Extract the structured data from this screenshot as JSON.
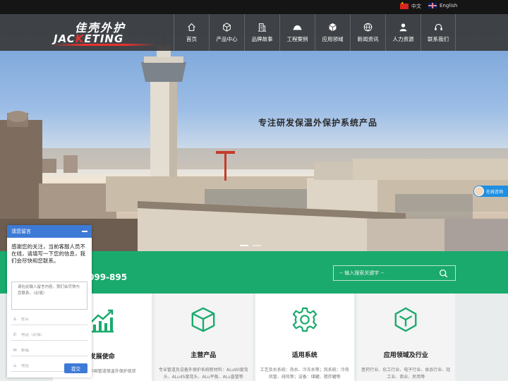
{
  "lang": {
    "cn": "中文",
    "en": "English"
  },
  "logo": {
    "cn": "佳壳外护",
    "en_pre": "JAC",
    "en_red": "K",
    "en_post": "ETING"
  },
  "nav": [
    {
      "label": "首页",
      "icon": "home-icon"
    },
    {
      "label": "产品中心",
      "icon": "cube-icon"
    },
    {
      "label": "品牌故事",
      "icon": "building-icon"
    },
    {
      "label": "工程案例",
      "icon": "helmet-icon"
    },
    {
      "label": "应用领域",
      "icon": "box-icon"
    },
    {
      "label": "新闻资讯",
      "icon": "globe-icon"
    },
    {
      "label": "人力资源",
      "icon": "person-icon"
    },
    {
      "label": "联系我们",
      "icon": "headset-icon"
    }
  ],
  "hero": {
    "slogan": "专注研发保温外保护系统产品"
  },
  "online": {
    "label": "在线咨询"
  },
  "contact": {
    "hotline": "099-895"
  },
  "search": {
    "placeholder": "-- 输入搜索关键字 --"
  },
  "cards": [
    {
      "title": "发展使命",
      "desc": "使命，改变中国管道保温外保护现状",
      "icon": "chart-growth-icon"
    },
    {
      "title": "主营产品",
      "desc": "专业管道及设备外保护系统新材料：ALu90度弯头、ALu45度弯头、ALu平板、ALu直管等",
      "icon": "cube-icon"
    },
    {
      "title": "适用系统",
      "desc": "工艺及水系统：热水、冷冻水等；风系统：冷热风管、排风等；设备：储罐、搅拌罐等",
      "icon": "gear-icon"
    },
    {
      "title": "应用领域及行业",
      "desc": "医药行业、化工行业、电子行业、食品行业、轻工业、商业、民用等",
      "icon": "hex-cube-icon"
    }
  ],
  "message": {
    "title": "请您留言",
    "notice": "感谢您的关注，当前客服人员不在线，请填写一下您的信息，我们会尽快和您联系。",
    "textarea_placeholder": "请在此输入留言内容，我们会尽快与您联系。（必填）",
    "name_placeholder": "姓名",
    "phone_placeholder": "电话（必填）",
    "email_placeholder": "邮箱",
    "address_placeholder": "地址",
    "submit": "提交"
  },
  "colors": {
    "green": "#1aaa6d",
    "header": "#3a3a3a",
    "chat_blue": "#3d7ad6",
    "logo_red": "#e8322e"
  }
}
